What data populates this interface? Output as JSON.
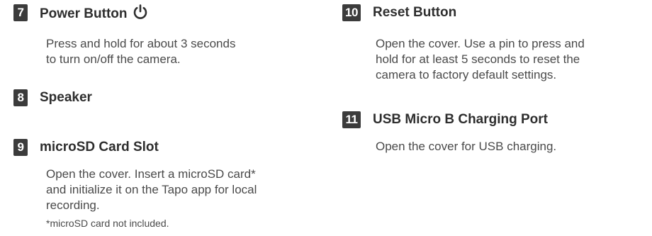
{
  "items": [
    {
      "number": "7",
      "title": "Power Button",
      "icon": "power-icon",
      "description": [
        "Press and hold for about 3 seconds",
        "to turn on/off the camera."
      ]
    },
    {
      "number": "8",
      "title": "Speaker"
    },
    {
      "number": "9",
      "title": "microSD Card Slot",
      "description": [
        "Open the cover. Insert a microSD card*",
        "and initialize it on the Tapo app for local",
        "recording."
      ],
      "note": "*microSD card not included."
    },
    {
      "number": "10",
      "title": "Reset Button",
      "description": [
        "Open the cover. Use a pin to press and",
        "hold for at least 5 seconds to reset the",
        "camera to factory default settings."
      ]
    },
    {
      "number": "11",
      "title": "USB Micro B Charging Port",
      "description": [
        "Open the cover for USB charging."
      ]
    }
  ]
}
